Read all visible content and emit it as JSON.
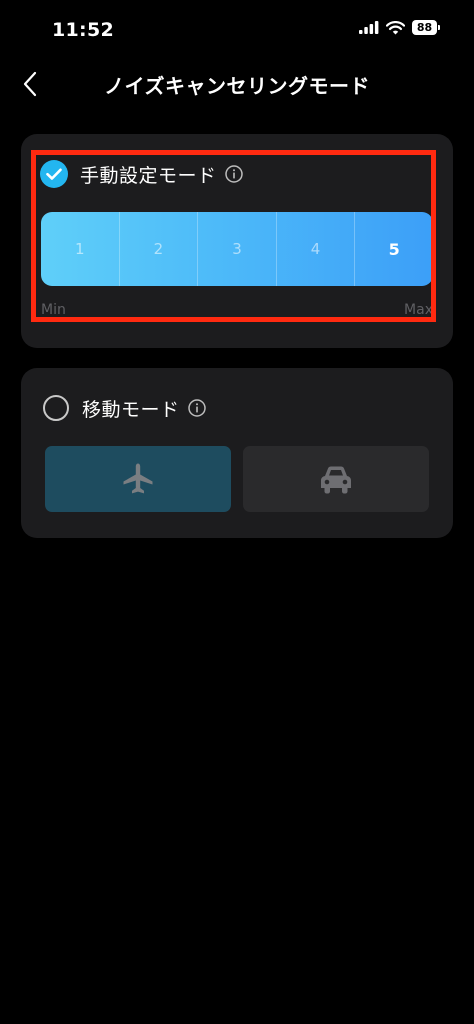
{
  "status_bar": {
    "time": "11:52",
    "battery": "88"
  },
  "nav": {
    "title": "ノイズキャンセリングモード"
  },
  "manual_mode": {
    "title": "手動設定モード",
    "checked": true,
    "levels": [
      "1",
      "2",
      "3",
      "4",
      "5"
    ],
    "selected_level": "5",
    "min_label": "Min",
    "max_label": "Max"
  },
  "travel_mode": {
    "title": "移動モード",
    "checked": false,
    "options": [
      "airplane-icon",
      "car-icon"
    ],
    "selected_option": "airplane-icon"
  },
  "colors": {
    "accent": "#23b6f0",
    "highlight": "#ff2a10",
    "card": "#1c1c1e"
  }
}
